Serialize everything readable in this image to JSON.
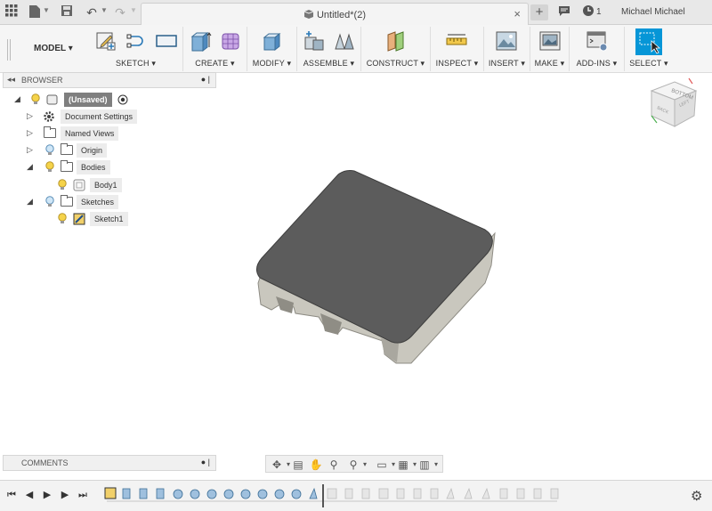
{
  "titlebar": {
    "doc_title": "Untitled*(2)",
    "user_name": "Michael Michael",
    "job_count": "1",
    "close_glyph": "×",
    "new_tab_glyph": "+"
  },
  "toolbar": {
    "workspace_label": "MODEL ▾",
    "groups": [
      {
        "label": "SKETCH ▾"
      },
      {
        "label": "CREATE ▾"
      },
      {
        "label": "MODIFY ▾"
      },
      {
        "label": "ASSEMBLE ▾"
      },
      {
        "label": "CONSTRUCT ▾"
      },
      {
        "label": "INSPECT ▾"
      },
      {
        "label": "INSERT ▾"
      },
      {
        "label": "MAKE ▾"
      },
      {
        "label": "ADD-INS ▾"
      },
      {
        "label": "SELECT ▾"
      }
    ]
  },
  "browser": {
    "title": "BROWSER",
    "root_label": "(Unsaved)",
    "items": [
      {
        "label": "Document Settings",
        "icon": "gear-icon"
      },
      {
        "label": "Named Views",
        "icon": "folder-icon"
      },
      {
        "label": "Origin",
        "icon": "folder-icon"
      },
      {
        "label": "Bodies",
        "icon": "folder-icon"
      },
      {
        "label": "Body1",
        "icon": "body-icon"
      },
      {
        "label": "Sketches",
        "icon": "folder-icon"
      },
      {
        "label": "Sketch1",
        "icon": "sketch-icon"
      }
    ]
  },
  "viewcube": {
    "face_top": "BOTTOM",
    "face_front": "BACK",
    "face_right": "LEFT"
  },
  "comments": {
    "title": "COMMENTS"
  },
  "colors": {
    "accent_select": "#0696d7",
    "model_top": "#5c5c5c",
    "model_side": "#c9c7be"
  }
}
